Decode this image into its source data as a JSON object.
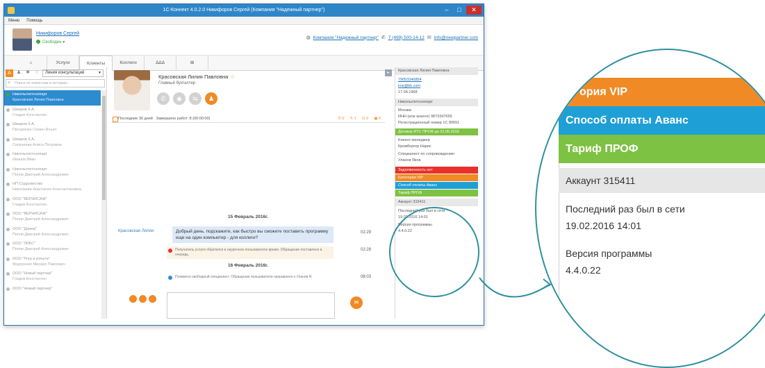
{
  "window": {
    "title": "1С-Коннект 4.0.2.0 Никифоров Сергей (Компания \"Надежный партнер\")",
    "minimize": "–",
    "maximize": "□",
    "close": "✕"
  },
  "menu": [
    "Меню",
    "Помощь"
  ],
  "user": {
    "name": "Никифоров Сергей",
    "status": "Свободен ▾"
  },
  "company": {
    "name": "Компания \"Надежный партнер\"",
    "phone": "7 (499) 500-14-12",
    "email": "info@newpartner.com"
  },
  "tabs": [
    "⌂",
    "Услуги",
    "Клиенты",
    "Коллеги",
    "ΔΔΔ",
    "⊞"
  ],
  "left": {
    "filter": "Линия консультаций",
    "search_placeholder": "Поиск по клиентам и истории...",
    "contacts": [
      {
        "line1": "Никольспетснопарт",
        "line2": "Красовская Лилия Павловна"
      },
      {
        "line1": "Шмаров К.А.",
        "line2": "Гладов Константин"
      },
      {
        "line1": "Шмаров К.А.",
        "line2": "Писаренко Семен Ильич"
      },
      {
        "line1": "Шмаров К.А.",
        "line2": "Селезнева Алиса Петровна"
      },
      {
        "line1": "Никольспетснопарт",
        "line2": "Иванов Иван"
      },
      {
        "line1": "Никольспетснопарт",
        "line2": "Попов Дмитрий Александрович"
      },
      {
        "line1": "НП Содружество",
        "line2": "Николаева Анастасия Константиновна"
      },
      {
        "line1": "ООО \"ВЕРНИСАЖ\"",
        "line2": "Гладов Константин"
      },
      {
        "line1": "ООО \"ВЕРНИСАЖ\"",
        "line2": "Попов Дмитрий Александрович"
      },
      {
        "line1": "ООО \"Домна\"",
        "line2": "Попов Дмитрий Александрович"
      },
      {
        "line1": "ООО \"ЛИКС\"",
        "line2": "Попов Дмитрий Александрович"
      },
      {
        "line1": "ООО \"Рога и копыта\"",
        "line2": "Федоренко Михаил Павлович"
      },
      {
        "line1": "ООО \"Новый партнер\"",
        "line2": "Гладов Константин"
      },
      {
        "line1": "ООО \"Новый партнер\"",
        "line2": ""
      }
    ]
  },
  "contact": {
    "name": "Красовская Лилия Павловна",
    "role": "Главный бухгалтер",
    "period": "Последние 30 дней",
    "closed": "Завершено работ: 8 (00:00:00)",
    "counters": [
      "0",
      "1",
      "0",
      "0"
    ]
  },
  "chat": {
    "date1": "15 Февраль 2016г.",
    "sender": "Красовская Лилия",
    "message": "Добрый день, подскажите, как быстро вы сможете поставить программу еще на один компьютер - для коллеги?",
    "time1": "02:29",
    "sys1": "Получатель услуги обратился в неурочное пользователю время. Обращение поставлено в очередь.",
    "time2": "02:29",
    "date2": "16 Февраль 2016г.",
    "sys2": "Появился свободный специалист. Обращение пользователя направлено к Уланов Я.",
    "time3": "08:03"
  },
  "right": {
    "name": "Красовская Лилия Павловна",
    "phone": "79053346854",
    "email": "kris@bk.com",
    "birth": "17.04.1968",
    "org_head": "Никольспетснопарт",
    "city": "Москва",
    "inn": "ИНН (или аналог) 9873347659",
    "reg": "Регистрационный номер 1С 80551",
    "contract": "Договор ИТС ПРОФ до 31.05.2016",
    "manager_label": "Клиент-менеджер",
    "manager": "Кромбергер Нарис",
    "specialist_label": "Специалист по сопровождению",
    "specialist": "Уланов Яков",
    "badges": [
      {
        "text": "Задолженность нет",
        "color": "#e8312a"
      },
      {
        "text": "Категория VIP",
        "color": "#f08a24"
      },
      {
        "text": "Способ оплаты Аванс",
        "color": "#1e9fd6"
      },
      {
        "text": "Тариф ПРОФ",
        "color": "#7dc242"
      }
    ],
    "account": "Аккаунт 315411",
    "last_seen_label": "Последний раз был в сети",
    "last_seen": "19.02.2016 14:01",
    "version_label": "Версия программы",
    "version": "4.4.0.22"
  },
  "zoom": {
    "badge_vip": "ория VIP",
    "badge_pay": "Способ оплаты Аванс",
    "badge_tariff": "Тариф ПРОФ",
    "account": "Аккаунт 315411",
    "last_seen_label": "Последний раз был в сети",
    "last_seen": "19.02.2016 14:01",
    "version_label": "Версия программы",
    "version": "4.4.0.22"
  },
  "colors": {
    "accent": "#2e86c9",
    "orange": "#f08a24",
    "blue_badge": "#1e9fd6",
    "green_badge": "#7dc242",
    "red_badge": "#e8312a",
    "circle": "#2f8fa0"
  }
}
